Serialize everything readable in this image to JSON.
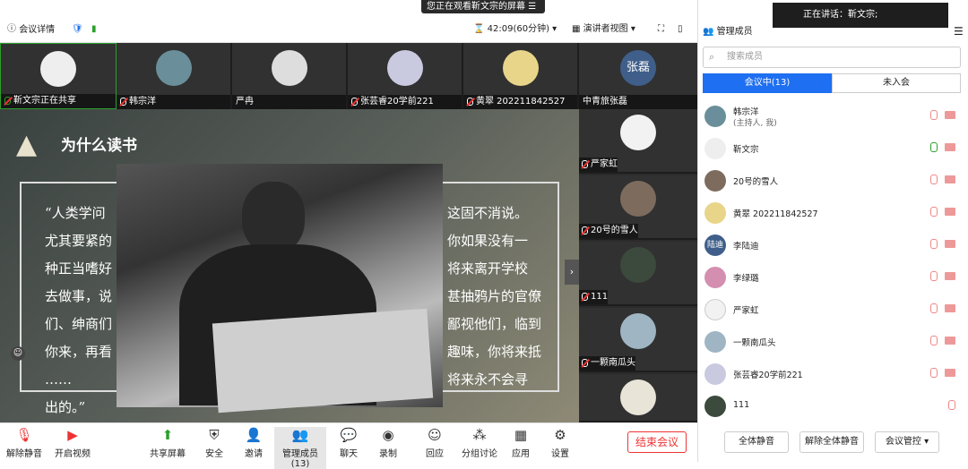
{
  "banner": {
    "watching": "您正在观看靳文宗的屏幕",
    "menu_glyph": "☰"
  },
  "topbar": {
    "meeting_details": "会议详情",
    "timer": "42:09(60分钟)",
    "view_mode": "演讲者视图"
  },
  "tiles": [
    {
      "name": "靳文宗正在共享"
    },
    {
      "name": "韩宗洋"
    },
    {
      "name": "严冉"
    },
    {
      "name": "张芸睿20学前221"
    },
    {
      "name": "黄翠 202211842527"
    },
    {
      "name": "中青旅张磊",
      "avatar_text": "张磊"
    }
  ],
  "slide": {
    "title": "为什么读书",
    "poem_left": [
      "“人类学问",
      "尤其要紧的",
      "种正当嗜好",
      "去做事，说",
      "们、绅商们",
      "你来，再看",
      "……",
      "出的。”"
    ],
    "poem_right": [
      "这固不消说。",
      "你如果没有一",
      "将来离开学校",
      "甚抽鸦片的官僚",
      "鄙视他们，临到",
      "趣味，你将来抵",
      "将来永不会寻"
    ]
  },
  "right_tiles": [
    {
      "name": "严家虹"
    },
    {
      "name": "20号的雪人"
    },
    {
      "name": "111"
    },
    {
      "name": "一颗南瓜头"
    }
  ],
  "toolbar": {
    "unmute": "解除静音",
    "start_video": "开启视频",
    "share": "共享屏幕",
    "security": "安全",
    "invite": "邀请",
    "members": "管理成员(13)",
    "chat": "聊天",
    "record": "录制",
    "reactions": "回应",
    "breakout": "分组讨论",
    "apps": "应用",
    "settings": "设置",
    "end": "结束会议"
  },
  "panel": {
    "title": "管理成员",
    "speaking_label": "正在讲话：",
    "speaking_name": "靳文宗;",
    "search_placeholder": "搜索成员",
    "tab_in": "会议中(13)",
    "tab_out": "未入会",
    "members": [
      {
        "name": "韩宗洋",
        "sub": "(主持人, 我)"
      },
      {
        "name": "靳文宗",
        "sub": ""
      },
      {
        "name": "20号的雪人",
        "sub": ""
      },
      {
        "name": "黄翠 202211842527",
        "sub": ""
      },
      {
        "name": "李陆迪",
        "sub": "",
        "avatar_text": "陆迪"
      },
      {
        "name": "李绿璐",
        "sub": ""
      },
      {
        "name": "严家虹",
        "sub": ""
      },
      {
        "name": "一颗南瓜头",
        "sub": ""
      },
      {
        "name": "张芸睿20学前221",
        "sub": ""
      },
      {
        "name": "111",
        "sub": ""
      }
    ],
    "mute_all": "全体静音",
    "unmute_all": "解除全体静音",
    "controls": "会议管控"
  }
}
